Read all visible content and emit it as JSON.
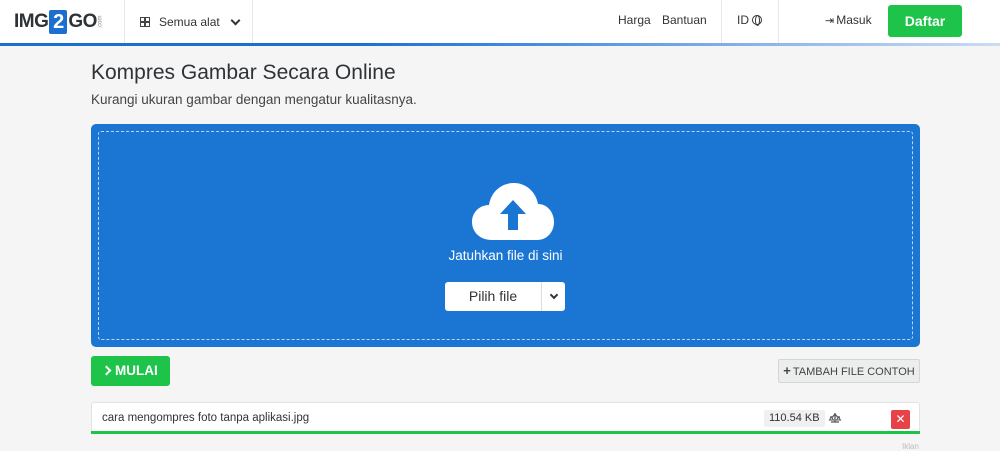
{
  "header": {
    "logo": {
      "left": "IMG",
      "mid": "2",
      "right": "GO",
      "suffix": ".com"
    },
    "tools_label": "Semua alat",
    "pricing": "Harga",
    "help": "Bantuan",
    "language": "ID",
    "login": "Masuk",
    "signup": "Daftar",
    "accent_color": "#1a6fcf",
    "signup_color": "#1dc449"
  },
  "page": {
    "title": "Kompres Gambar Secara Online",
    "subtitle": "Kurangi ukuran gambar dengan mengatur kualitasnya."
  },
  "upload": {
    "drop_text": "Jatuhkan file di sini",
    "choose_file": "Pilih file",
    "background_color": "#1b76d3",
    "icon": "cloud-upload-icon"
  },
  "actions": {
    "start": "MULAI",
    "add_sample": "TAMBAH FILE CONTOH"
  },
  "files": [
    {
      "name": "cara mengompres foto tanpa aplikasi.jpg",
      "size": "110.54 KB",
      "upload_progress": 1.0
    }
  ],
  "ad_label": "Iklan"
}
